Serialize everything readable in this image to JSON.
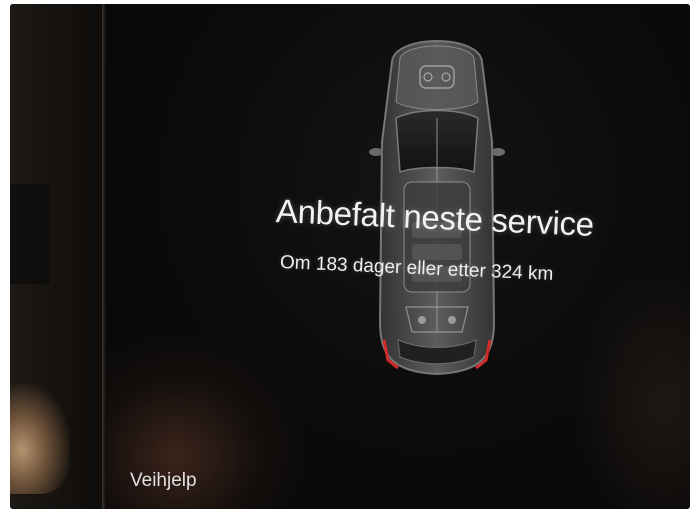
{
  "service": {
    "title": "Anbefalt neste service",
    "detail": "Om 183 dager eller etter 324 km",
    "days_remaining": 183,
    "distance_remaining_km": 324
  },
  "footer": {
    "roadside_label": "Veihjelp"
  },
  "icons": {
    "vehicle": "car-top-view-icon"
  },
  "colors": {
    "screen_background": "#0b0b0b",
    "text": "#f2f2f2",
    "car_indicator": "#d22a2a"
  }
}
